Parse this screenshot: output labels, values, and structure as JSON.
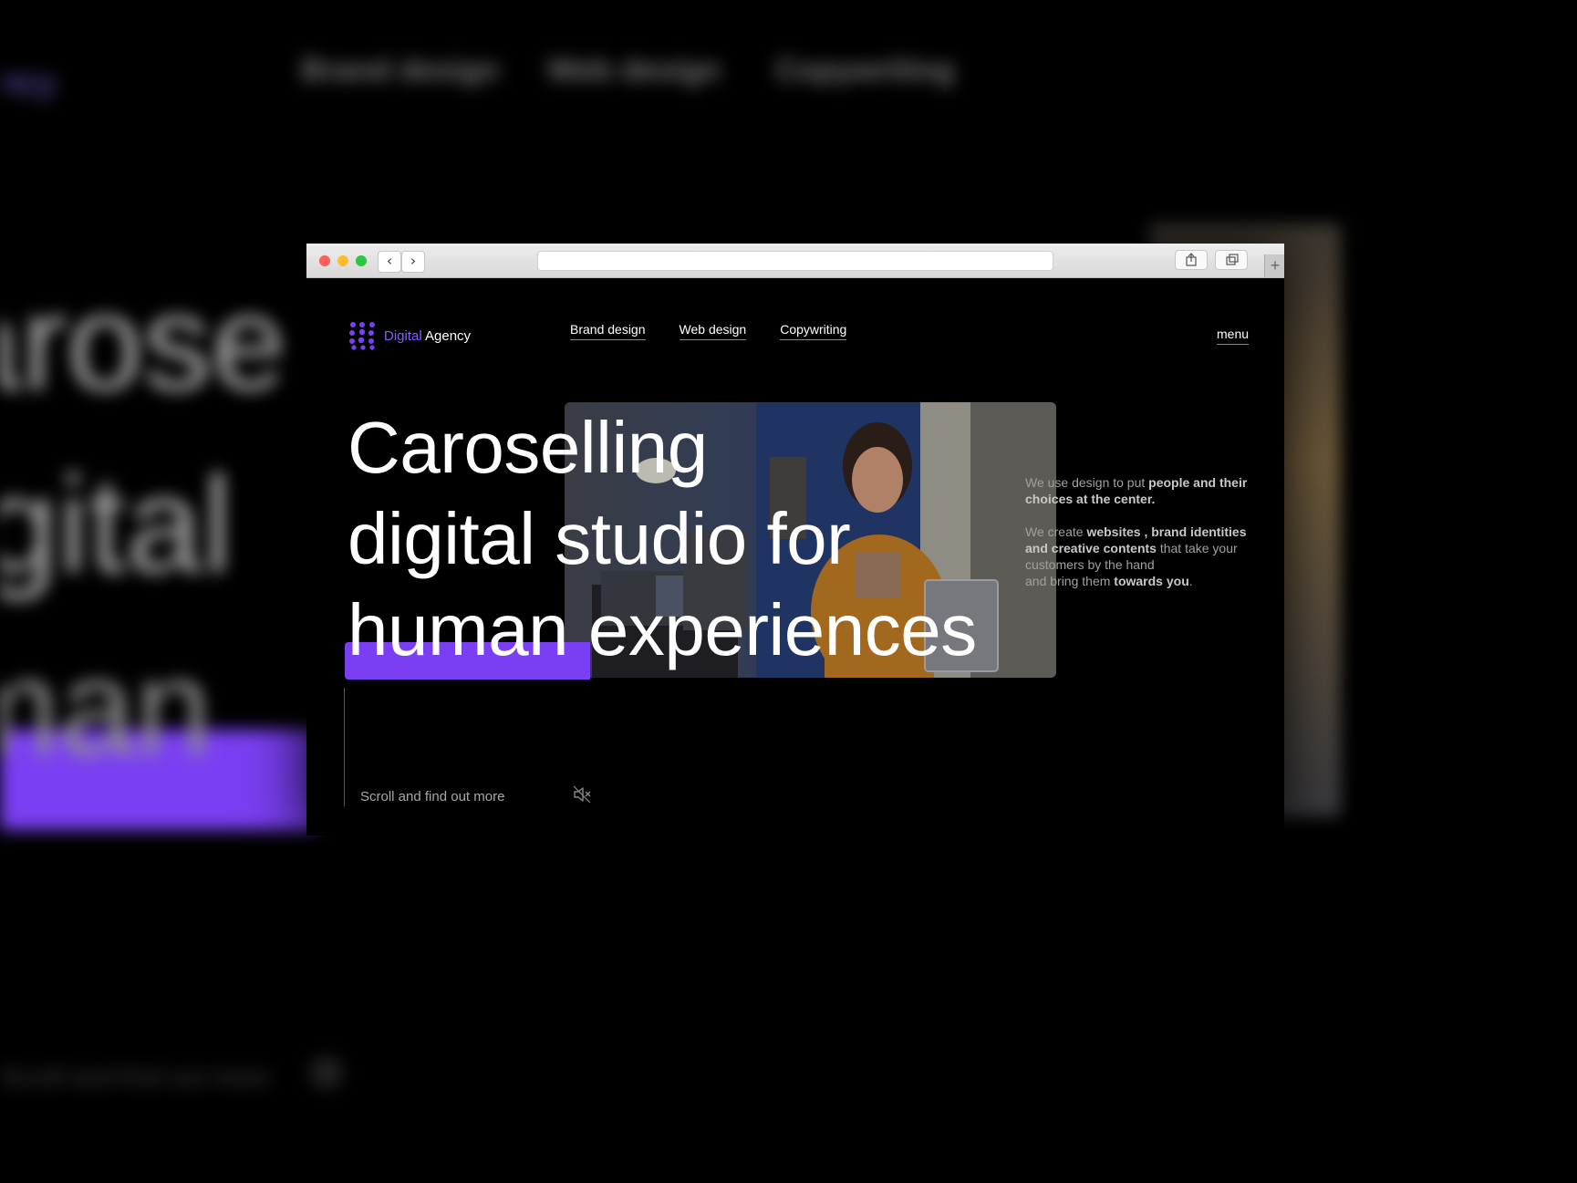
{
  "brand": {
    "name_highlight": "Digital",
    "name_rest": " Agency",
    "accent_color": "#7a3ff2"
  },
  "nav": {
    "links": [
      "Brand design",
      "Web design",
      "Copywriting"
    ],
    "menu": "menu"
  },
  "hero": {
    "line1": "Caroselling",
    "line2": "digital studio for",
    "line3_highlight": "human",
    "line3_rest": " experiences"
  },
  "description": {
    "p1_plain": "We use design to put ",
    "p1_bold": "people and their choices at the center.",
    "p2_plain1": "We create ",
    "p2_bold1": "websites , brand identities and creative contents",
    "p2_plain2": " that take your customers by the hand",
    "p2_plain3": "and bring them ",
    "p2_bold2": "towards you",
    "p2_end": "."
  },
  "scroll": {
    "text": "Scroll and find out more"
  },
  "browser": {
    "address": "",
    "new_tab_symbol": "+",
    "back_symbol": "‹",
    "forward_symbol": "›"
  },
  "backdrop": {
    "logo": "gency",
    "nav": [
      "Brand design",
      "Web design",
      "Copywriting"
    ],
    "big_lines": [
      "arose",
      "gital",
      "man"
    ],
    "scroll_text": "Scroll and find out more"
  },
  "icons": {
    "logo": "dot-grid-icon",
    "mute": "speaker-muted-icon",
    "share": "share-icon",
    "tabs": "tabs-icon"
  }
}
